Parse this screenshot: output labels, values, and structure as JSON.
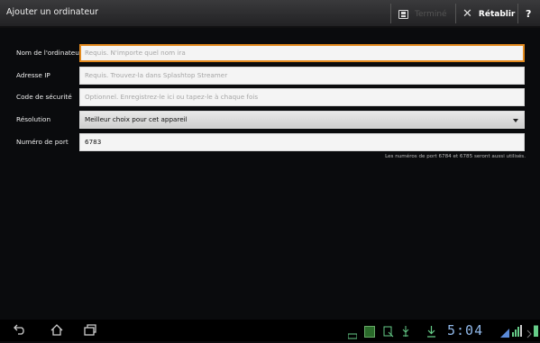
{
  "header": {
    "title": "Ajouter un ordinateur",
    "done_label": "Terminé",
    "reset_label": "Rétablir",
    "help_label": "?"
  },
  "form": {
    "name": {
      "label": "Nom de l'ordinateur",
      "value": "",
      "placeholder": "Requis. N'importe quel nom ira"
    },
    "ip": {
      "label": "Adresse IP",
      "value": "",
      "placeholder": "Requis. Trouvez-la dans Splashtop Streamer"
    },
    "security": {
      "label": "Code de sécurité",
      "value": "",
      "placeholder": "Optionnel. Enregistrez-le ici ou tapez-le à chaque fois"
    },
    "resolution": {
      "label": "Résolution",
      "value": "Meilleur choix pour cet appareil"
    },
    "port": {
      "label": "Numéro de port",
      "value": "6783"
    },
    "port_note": "Les numéros de port 6784 et 6785 seront aussi utilisés."
  },
  "statusbar": {
    "clock": "5:04"
  },
  "icons": {
    "save": "floppy-disk-icon",
    "close": "x-icon",
    "back": "back-arrow-icon",
    "home": "home-icon",
    "recent": "recent-apps-icon"
  },
  "colors": {
    "focus_border": "#e38a1e",
    "clock": "#8fb7e8"
  }
}
